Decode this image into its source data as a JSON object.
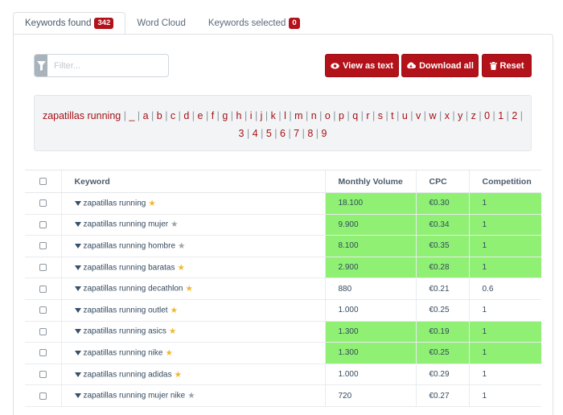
{
  "tabs": [
    {
      "label": "Keywords found",
      "badge": "342"
    },
    {
      "label": "Word Cloud"
    },
    {
      "label": "Keywords selected",
      "badge": "0"
    }
  ],
  "filter": {
    "placeholder": "Filter..."
  },
  "buttons": {
    "view_as_text": "View as text",
    "download_all": "Download all",
    "reset": "Reset"
  },
  "colors": {
    "accent": "#b3121a",
    "highlight": "#8ff073",
    "filter_button": "#a9b3bb"
  },
  "letter_filter": {
    "seed": "zapatillas running",
    "items": [
      "_",
      "a",
      "b",
      "c",
      "d",
      "e",
      "f",
      "g",
      "h",
      "i",
      "j",
      "k",
      "l",
      "m",
      "n",
      "o",
      "p",
      "q",
      "r",
      "s",
      "t",
      "u",
      "v",
      "w",
      "x",
      "y",
      "z",
      "0",
      "1",
      "2",
      "3",
      "4",
      "5",
      "6",
      "7",
      "8",
      "9"
    ]
  },
  "table": {
    "headers": {
      "keyword": "Keyword",
      "volume": "Monthly Volume",
      "cpc": "CPC",
      "competition": "Competition"
    },
    "rows": [
      {
        "keyword": "zapatillas running",
        "star": "gold",
        "volume": "18.100",
        "cpc": "€0.30",
        "competition": "1",
        "highlight": true
      },
      {
        "keyword": "zapatillas running mujer",
        "star": "gray",
        "volume": "9.900",
        "cpc": "€0.34",
        "competition": "1",
        "highlight": true
      },
      {
        "keyword": "zapatillas running hombre",
        "star": "gray",
        "volume": "8.100",
        "cpc": "€0.35",
        "competition": "1",
        "highlight": true
      },
      {
        "keyword": "zapatillas running baratas",
        "star": "gold",
        "volume": "2.900",
        "cpc": "€0.28",
        "competition": "1",
        "highlight": true
      },
      {
        "keyword": "zapatillas running decathlon",
        "star": "gold",
        "volume": "880",
        "cpc": "€0.21",
        "competition": "0.6",
        "highlight": false
      },
      {
        "keyword": "zapatillas running outlet",
        "star": "gold",
        "volume": "1.000",
        "cpc": "€0.25",
        "competition": "1",
        "highlight": false
      },
      {
        "keyword": "zapatillas running asics",
        "star": "gold",
        "volume": "1.300",
        "cpc": "€0.19",
        "competition": "1",
        "highlight": true
      },
      {
        "keyword": "zapatillas running nike",
        "star": "gold",
        "volume": "1.300",
        "cpc": "€0.25",
        "competition": "1",
        "highlight": true
      },
      {
        "keyword": "zapatillas running adidas",
        "star": "gold",
        "volume": "1.000",
        "cpc": "€0.29",
        "competition": "1",
        "highlight": false
      },
      {
        "keyword": "zapatillas running mujer nike",
        "star": "gray",
        "volume": "720",
        "cpc": "€0.27",
        "competition": "1",
        "highlight": false
      }
    ]
  }
}
